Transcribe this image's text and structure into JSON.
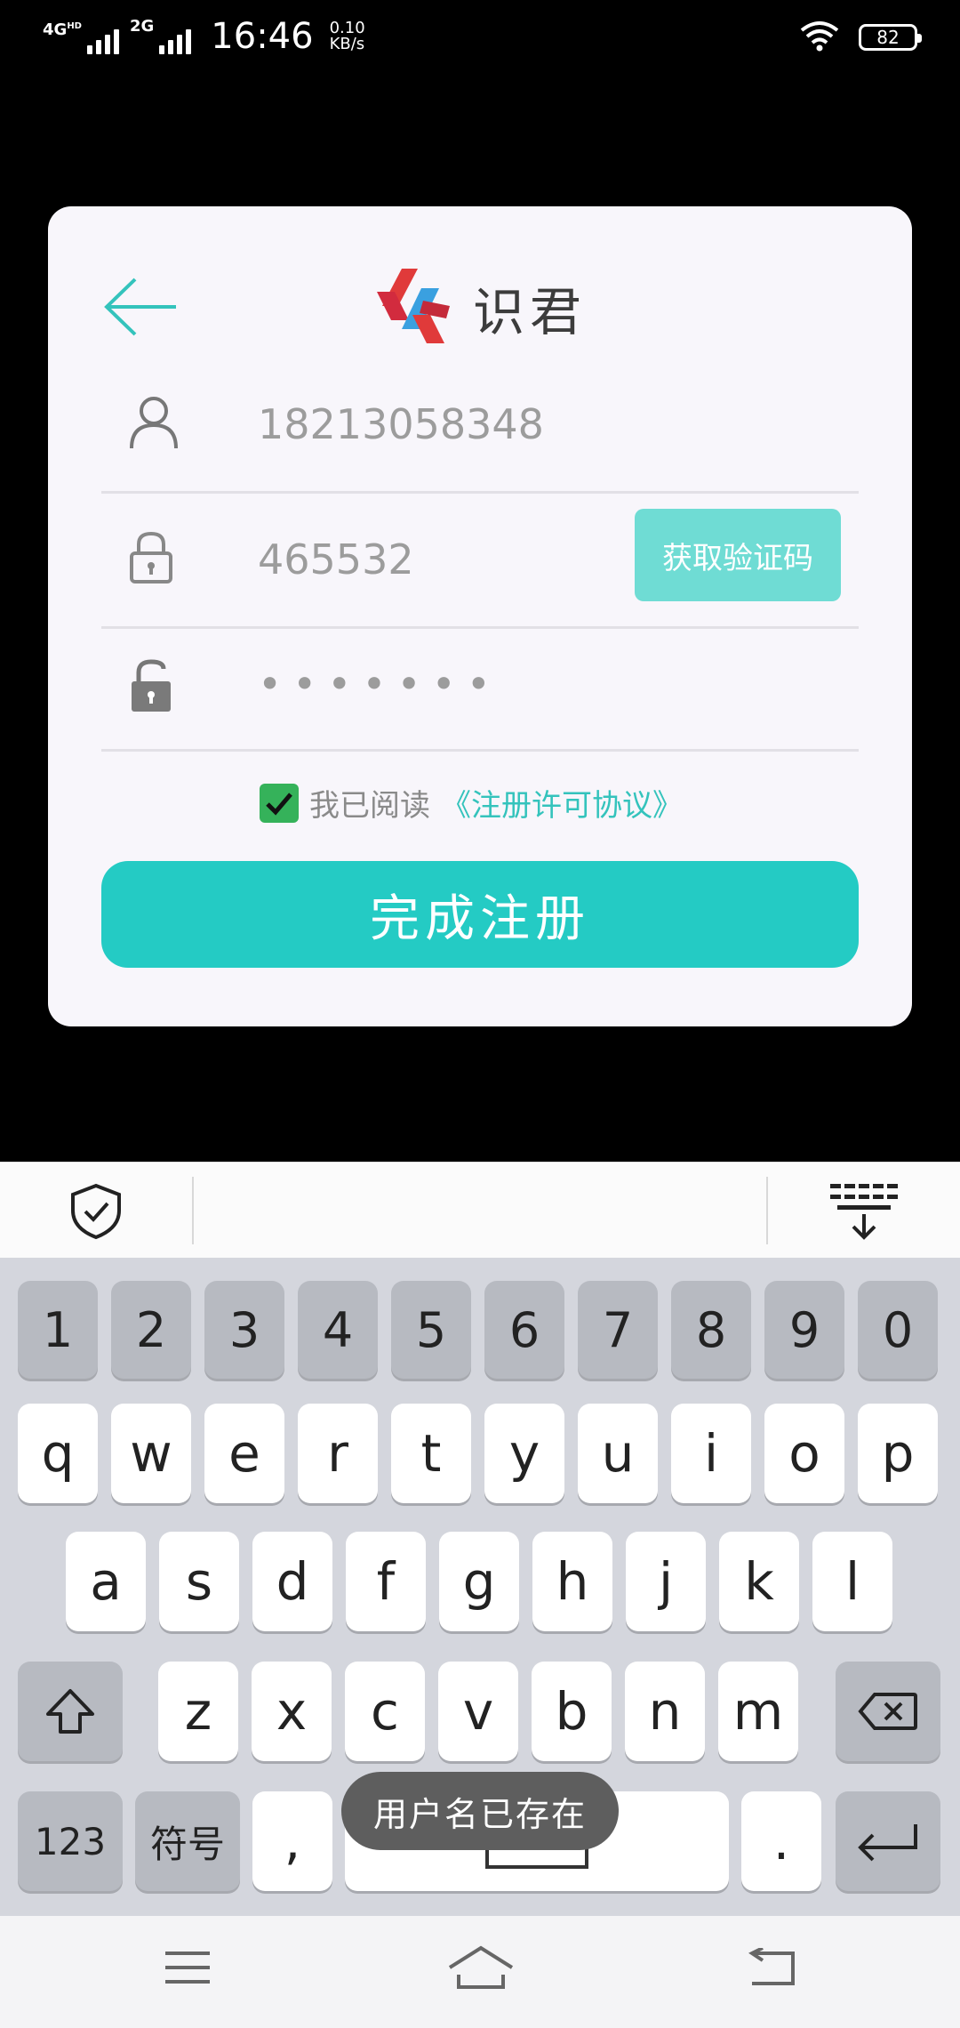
{
  "status_bar": {
    "signal1": "4G",
    "signal1_sup": "HD",
    "signal2": "2G",
    "time": "16:46",
    "speed_value": "0.10",
    "speed_unit": "KB/s",
    "battery": "82"
  },
  "card": {
    "logo_text": "识君",
    "phone_value": "18213058348",
    "code_value": "465532",
    "get_code_label": "获取验证码",
    "password_mask": "•••••••",
    "agree_text": "我已阅读",
    "agree_link": "《注册许可协议》",
    "submit_label": "完成注册"
  },
  "keyboard": {
    "number_row": [
      "1",
      "2",
      "3",
      "4",
      "5",
      "6",
      "7",
      "8",
      "9",
      "0"
    ],
    "row1": [
      "q",
      "w",
      "e",
      "r",
      "t",
      "y",
      "u",
      "i",
      "o",
      "p"
    ],
    "row2": [
      "a",
      "s",
      "d",
      "f",
      "g",
      "h",
      "j",
      "k",
      "l"
    ],
    "row3": [
      "z",
      "x",
      "c",
      "v",
      "b",
      "n",
      "m"
    ],
    "key_123": "123",
    "key_symbols": "符号",
    "key_comma": ",",
    "key_period": "."
  },
  "toast": "用户名已存在",
  "colors": {
    "accent": "#24cbc4",
    "accent_light": "#6fdcd4",
    "card_bg": "#f8f6fb",
    "checkbox": "#35b25a"
  }
}
